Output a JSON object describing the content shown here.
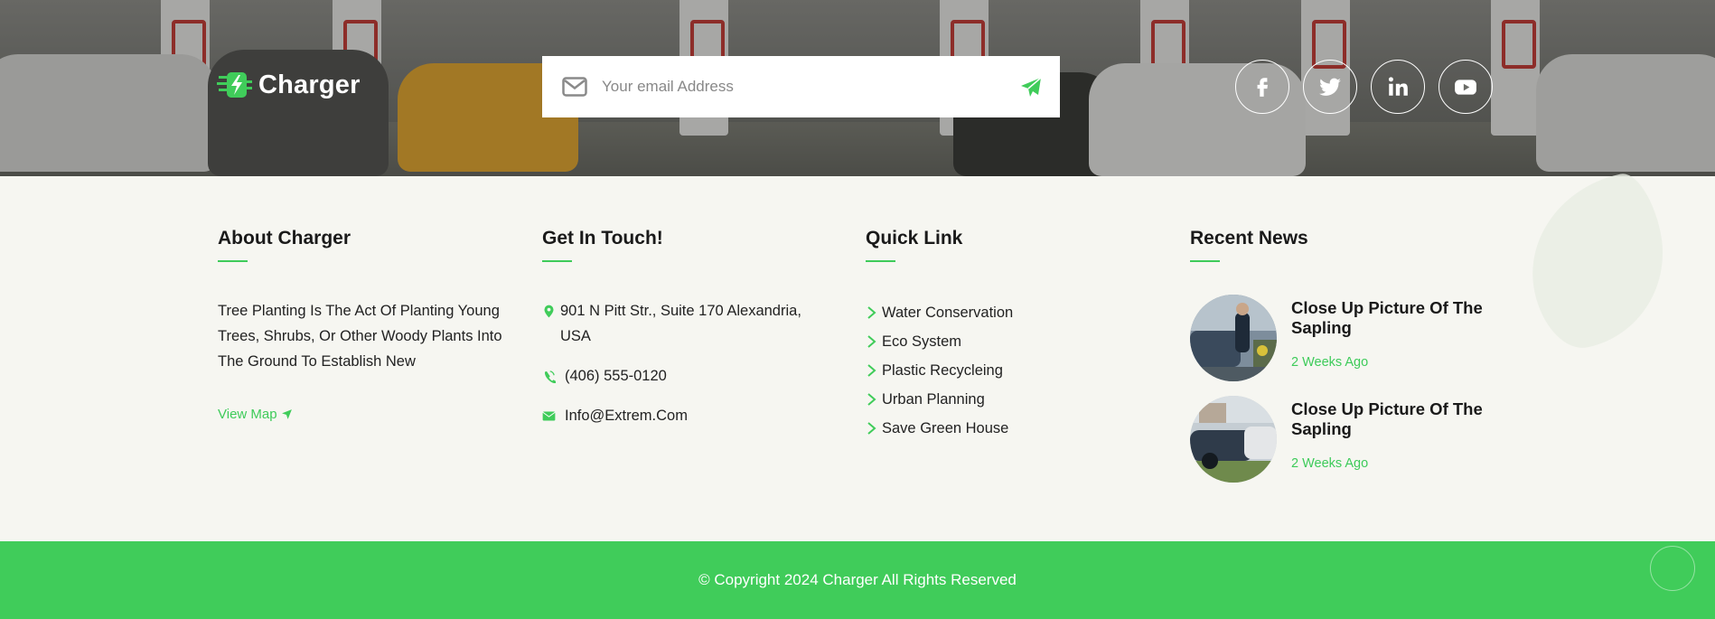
{
  "brand": {
    "name": "Charger",
    "logo_icon": "charger-plug-icon"
  },
  "subscribe": {
    "placeholder": "Your email Address",
    "mail_icon": "envelope-icon",
    "send_icon": "paper-plane-icon"
  },
  "social": [
    {
      "name": "facebook",
      "icon": "facebook-icon"
    },
    {
      "name": "twitter",
      "icon": "twitter-icon"
    },
    {
      "name": "linkedin",
      "icon": "linkedin-icon"
    },
    {
      "name": "youtube",
      "icon": "youtube-icon"
    }
  ],
  "about": {
    "title": "About Charger",
    "text": "Tree Planting Is The Act Of Planting Young Trees, Shrubs, Or Other Woody Plants Into The Ground To Establish New",
    "map_link": "View Map"
  },
  "contact": {
    "title": "Get In Touch!",
    "address": "901 N Pitt Str., Suite 170 Alexandria, USA",
    "phone": "(406) 555-0120",
    "email": "Info@Extrem.Com"
  },
  "quick_links": {
    "title": "Quick Link",
    "items": [
      "Water Conservation",
      "Eco System",
      "Plastic Recycleing",
      "Urban Planning",
      "Save Green House"
    ]
  },
  "news": {
    "title": "Recent News",
    "items": [
      {
        "title": "Close Up Picture Of The Sapling",
        "date": "2 Weeks Ago"
      },
      {
        "title": "Close Up Picture Of The Sapling",
        "date": "2 Weeks Ago"
      }
    ]
  },
  "copyright": "© Copyright 2024 Charger All Rights Reserved",
  "colors": {
    "accent": "#40cc5a",
    "heading": "#1a1a1a",
    "background": "#f6f6f1"
  }
}
